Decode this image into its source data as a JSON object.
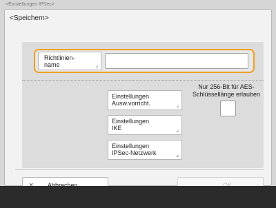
{
  "breadcrumb": "<Einstellungen IPSec>",
  "dialog": {
    "title": "<Speichern>"
  },
  "policy_name": {
    "button_label_line1": "Richtlinien-",
    "button_label_line2": "name",
    "value": ""
  },
  "settings_buttons": [
    {
      "line1": "Einstellungen",
      "line2": "Ausw.vorricht."
    },
    {
      "line1": "Einstellungen",
      "line2": "IKE"
    },
    {
      "line1": "Einstellungen",
      "line2": "IPSec-Netzwerk"
    }
  ],
  "aes_option": {
    "line1": "Nur 256-Bit für AES-",
    "line2": "Schlüssellänge erlauben",
    "checked": false
  },
  "footer": {
    "cancel_label": "Abbrechen",
    "ok_label": "OK",
    "ok_enabled": false
  },
  "icons": {
    "cancel": "×",
    "corner": "⌟",
    "ok_enter": "↲"
  },
  "colors": {
    "focus_outline": "#f0a020",
    "dialog_bg": "#f2f2f2",
    "content_bg": "#dcdcdc"
  }
}
